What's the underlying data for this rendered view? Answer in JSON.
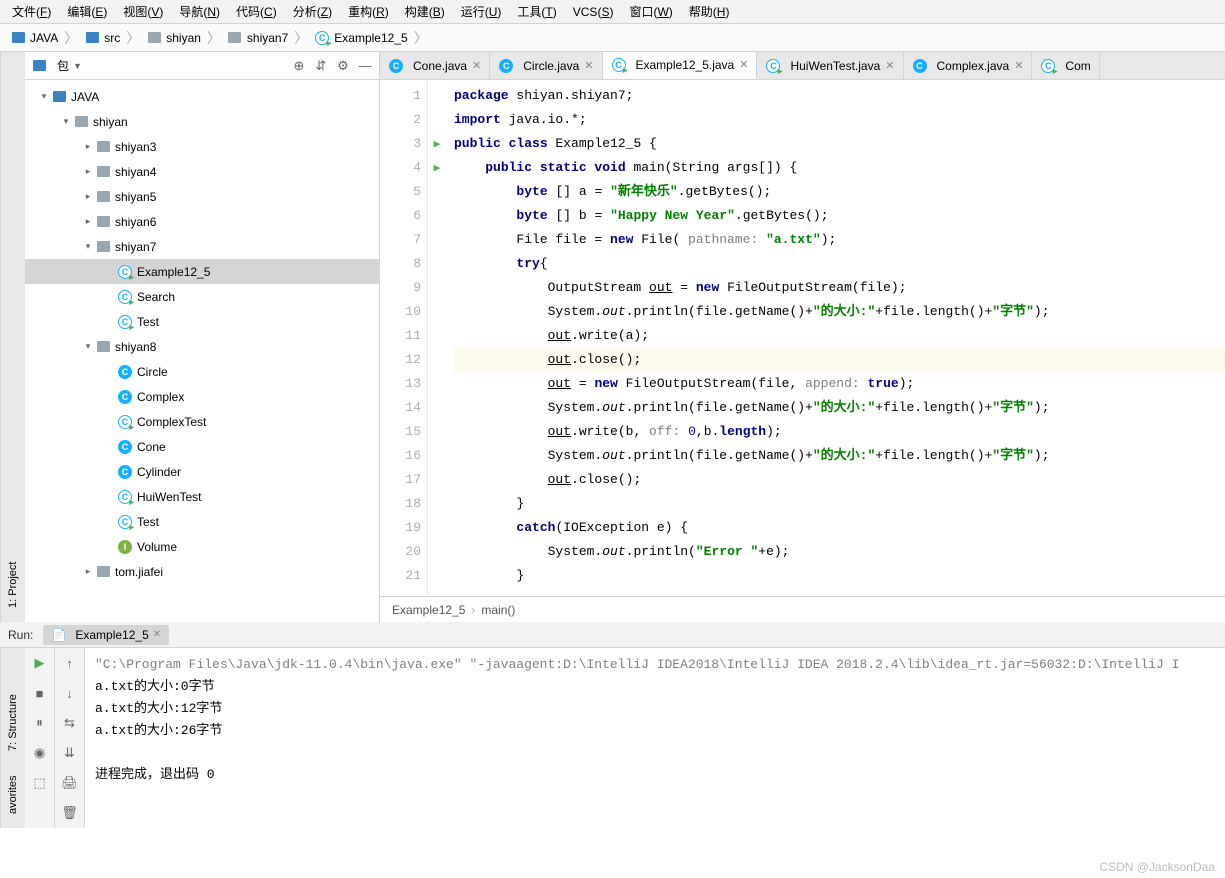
{
  "menu": [
    "文件(F)",
    "编辑(E)",
    "视图(V)",
    "导航(N)",
    "代码(C)",
    "分析(Z)",
    "重构(R)",
    "构建(B)",
    "运行(U)",
    "工具(T)",
    "VCS(S)",
    "窗口(W)",
    "帮助(H)"
  ],
  "breadcrumb": [
    {
      "label": "JAVA",
      "type": "folder-blue"
    },
    {
      "label": "src",
      "type": "folder-blue"
    },
    {
      "label": "shiyan",
      "type": "folder"
    },
    {
      "label": "shiyan7",
      "type": "folder"
    },
    {
      "label": "Example12_5",
      "type": "class-main"
    }
  ],
  "projectHeader": {
    "title": "包"
  },
  "sidebarLabels": {
    "project": "1: Project",
    "structure": "7: Structure",
    "favorites": "avorites"
  },
  "tree": [
    {
      "label": "JAVA",
      "indent": 0,
      "arrow": "▾",
      "icon": "folder-blue"
    },
    {
      "label": "shiyan",
      "indent": 1,
      "arrow": "▾",
      "icon": "folder"
    },
    {
      "label": "shiyan3",
      "indent": 2,
      "arrow": "▸",
      "icon": "folder"
    },
    {
      "label": "shiyan4",
      "indent": 2,
      "arrow": "▸",
      "icon": "folder"
    },
    {
      "label": "shiyan5",
      "indent": 2,
      "arrow": "▸",
      "icon": "folder"
    },
    {
      "label": "shiyan6",
      "indent": 2,
      "arrow": "▸",
      "icon": "folder"
    },
    {
      "label": "shiyan7",
      "indent": 2,
      "arrow": "▾",
      "icon": "folder"
    },
    {
      "label": "Example12_5",
      "indent": 3,
      "arrow": "",
      "icon": "class-main",
      "selected": true
    },
    {
      "label": "Search",
      "indent": 3,
      "arrow": "",
      "icon": "class-main"
    },
    {
      "label": "Test",
      "indent": 3,
      "arrow": "",
      "icon": "class-main"
    },
    {
      "label": "shiyan8",
      "indent": 2,
      "arrow": "▾",
      "icon": "folder"
    },
    {
      "label": "Circle",
      "indent": 3,
      "arrow": "",
      "icon": "class"
    },
    {
      "label": "Complex",
      "indent": 3,
      "arrow": "",
      "icon": "class"
    },
    {
      "label": "ComplexTest",
      "indent": 3,
      "arrow": "",
      "icon": "class-main"
    },
    {
      "label": "Cone",
      "indent": 3,
      "arrow": "",
      "icon": "class"
    },
    {
      "label": "Cylinder",
      "indent": 3,
      "arrow": "",
      "icon": "class"
    },
    {
      "label": "HuiWenTest",
      "indent": 3,
      "arrow": "",
      "icon": "class-main"
    },
    {
      "label": "Test",
      "indent": 3,
      "arrow": "",
      "icon": "class-main"
    },
    {
      "label": "Volume",
      "indent": 3,
      "arrow": "",
      "icon": "iface"
    },
    {
      "label": "tom.jiafei",
      "indent": 2,
      "arrow": "▸",
      "icon": "folder"
    }
  ],
  "tabs": [
    {
      "label": "Cone.java",
      "icon": "class"
    },
    {
      "label": "Circle.java",
      "icon": "class"
    },
    {
      "label": "Example12_5.java",
      "icon": "class-main",
      "active": true
    },
    {
      "label": "HuiWenTest.java",
      "icon": "class-main"
    },
    {
      "label": "Complex.java",
      "icon": "class"
    },
    {
      "label": "Com",
      "icon": "class-main",
      "nocc": true
    }
  ],
  "code": [
    "<span class='kw'>package</span> shiyan.shiyan7;",
    "<span class='kw'>import</span> java.io.*;",
    "<span class='kw'>public class</span> Example12_5 {",
    "    <span class='kw'>public static void</span> main(String args[]) {",
    "        <span class='kw'>byte</span> [] a = <span class='str'>\"新年快乐\"</span>.getBytes();",
    "        <span class='kw'>byte</span> [] b = <span class='str'>\"Happy New Year\"</span>.getBytes();",
    "        File file = <span class='kw'>new</span> File( <span class='param'>pathname:</span> <span class='str'>\"a.txt\"</span>);",
    "        <span class='kw'>try</span>{",
    "            OutputStream <span class='underline'>out</span> = <span class='kw'>new</span> FileOutputStream(file);",
    "            System.<span class='ital'>out</span>.println(file.getName()+<span class='str'>\"的大小:\"</span>+file.length()+<span class='str'>\"字节\"</span>);",
    "            <span class='underline'>out</span>.write(a);",
    "            <span class='underline'>out</span>.close();",
    "            <span class='underline'>out</span> = <span class='kw'>new</span> FileOutputStream(file, <span class='param'>append:</span> <span class='kw'>true</span>);",
    "            System.<span class='ital'>out</span>.println(file.getName()+<span class='str'>\"的大小:\"</span>+file.length()+<span class='str'>\"字节\"</span>);",
    "            <span class='underline'>out</span>.write(b, <span class='param'>off:</span> <span class='num'>0</span>,b.<span class='kw'>length</span>);",
    "            System.<span class='ital'>out</span>.println(file.getName()+<span class='str'>\"的大小:\"</span>+file.length()+<span class='str'>\"字节\"</span>);",
    "            <span class='underline'>out</span>.close();",
    "        }",
    "        <span class='kw'>catch</span>(IOException e) {",
    "            System.<span class='ital'>out</span>.println(<span class='str'>\"Error \"</span>+e);",
    "        }"
  ],
  "highlightLine": 12,
  "runGutters": [
    3,
    4
  ],
  "editorFooter": {
    "path": "Example12_5",
    "method": "main()"
  },
  "runTabLabel": "Run:",
  "runTab": "Example12_5",
  "console": {
    "cmd": "\"C:\\Program Files\\Java\\jdk-11.0.4\\bin\\java.exe\" \"-javaagent:D:\\IntelliJ IDEA2018\\IntelliJ IDEA 2018.2.4\\lib\\idea_rt.jar=56032:D:\\IntelliJ I",
    "lines": [
      "a.txt的大小:0字节",
      "a.txt的大小:12字节",
      "a.txt的大小:26字节",
      "",
      "进程完成，退出码 0"
    ]
  },
  "watermark": "CSDN @JacksonDaa"
}
